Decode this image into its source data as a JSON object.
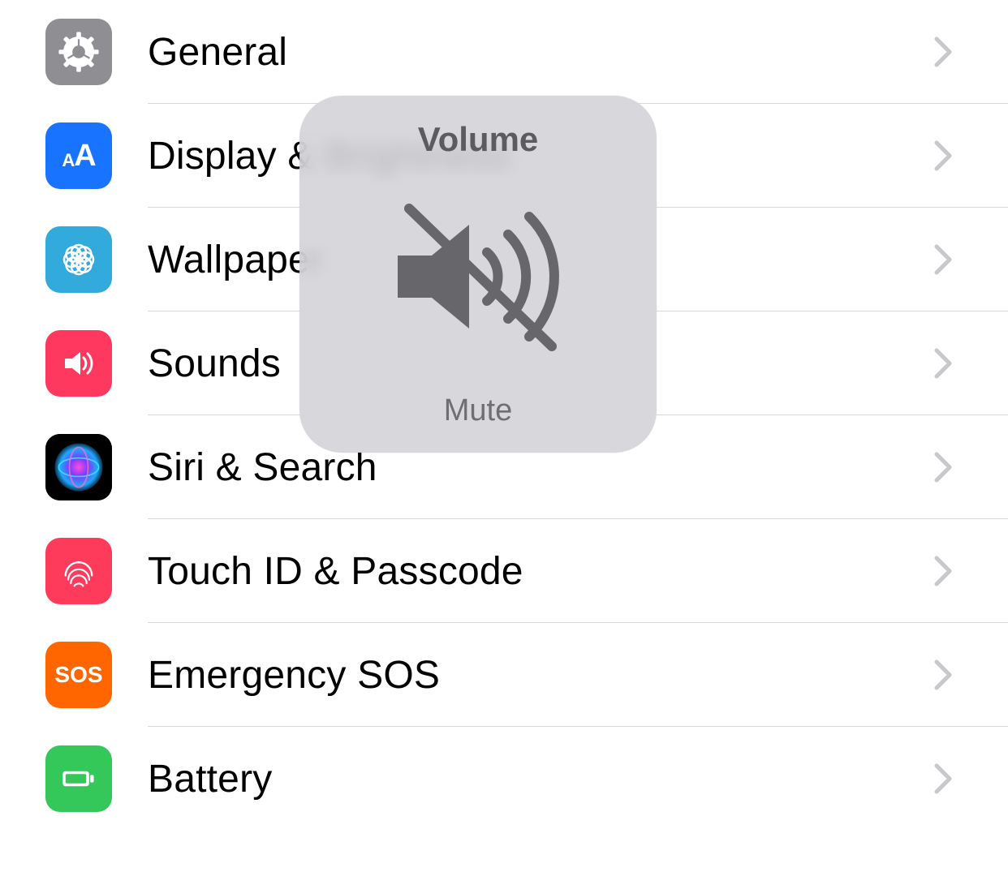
{
  "rows": [
    {
      "key": "general",
      "label": "General"
    },
    {
      "key": "display",
      "label": "Display & Brightness"
    },
    {
      "key": "wallpaper",
      "label": "Wallpaper"
    },
    {
      "key": "sounds",
      "label": "Sounds"
    },
    {
      "key": "siri",
      "label": "Siri & Search"
    },
    {
      "key": "touchid",
      "label": "Touch ID & Passcode"
    },
    {
      "key": "sos",
      "label": "Emergency SOS"
    },
    {
      "key": "battery",
      "label": "Battery"
    }
  ],
  "icon_text": {
    "display": "AA",
    "sos": "SOS"
  },
  "hud": {
    "title": "Volume",
    "subtitle": "Mute"
  }
}
